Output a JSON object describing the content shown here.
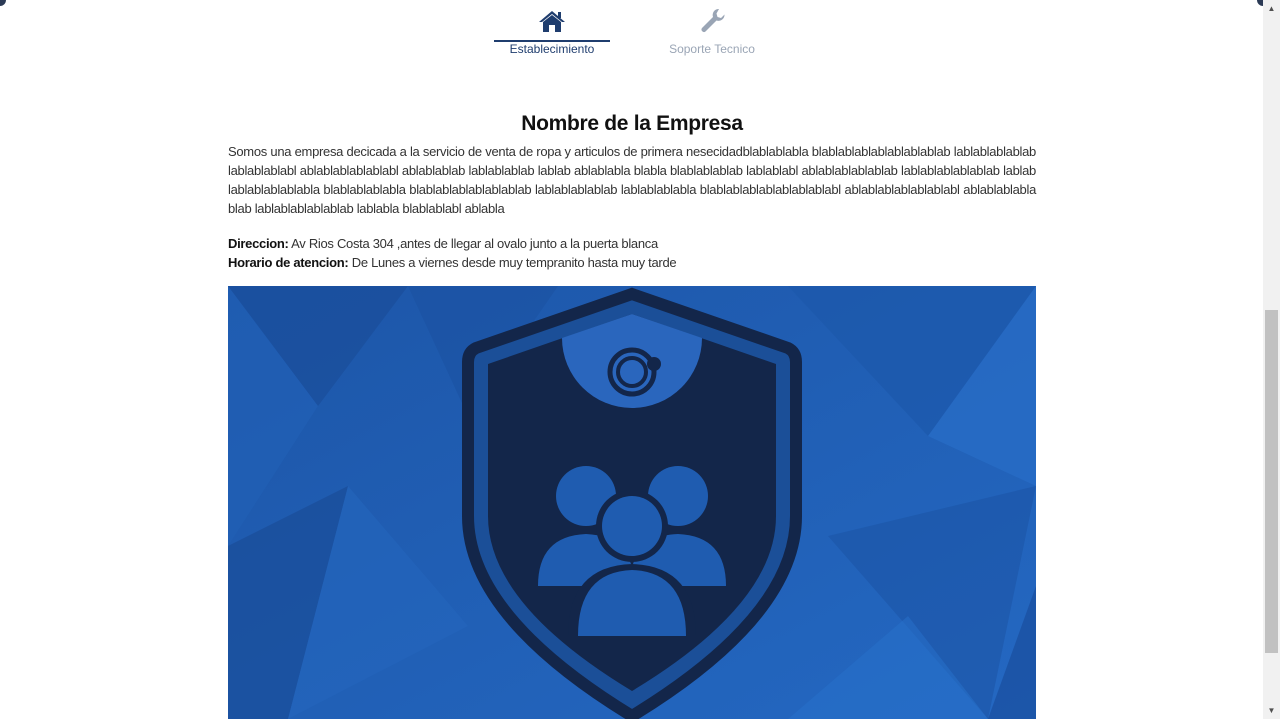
{
  "tabs": [
    {
      "label": "Establecimiento",
      "icon": "home-icon",
      "active": true
    },
    {
      "label": "Soporte Tecnico",
      "icon": "wrench-icon",
      "active": false
    }
  ],
  "company": {
    "title": "Nombre de la Empresa",
    "description": "Somos una empresa decicada a la servicio de venta de ropa y articulos de primera nesecidadblablablabla blablablablablablablablab lablablablablablablablablabl ablablablablablabl ablablablab lablablablab lablab ablablabla blabla blablablablab lablablabl ablablablablablab lablablablablablab lablablablablablablabla blablablablabla blablablablablablablab lablablablablab lablablablabla blablablablablablablablabl ablablablablablablabl ablablablablablab lablablablablablab lablabla blablablabl ablabla",
    "direccion_label": "Direccion:",
    "direccion_value": " Av Rios Costa 304 ,antes de llegar al ovalo junto a la puerta blanca",
    "horario_label": "Horario de atencion:",
    "horario_value": " De Lunes a viernes desde muy tempranito hasta muy tarde"
  },
  "colors": {
    "accent": "#1f3d6e",
    "inactive": "#9aa5b5",
    "hero_bg": "#1a5bb0",
    "shield": "#13264a"
  }
}
